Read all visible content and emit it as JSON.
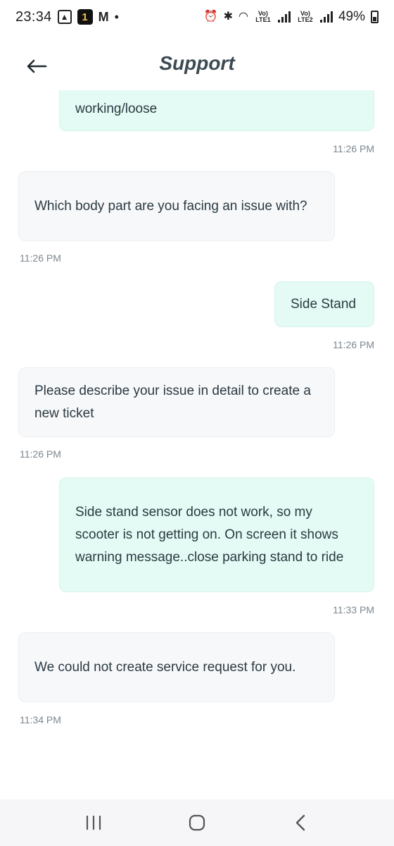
{
  "status_bar": {
    "time": "23:34",
    "badge": "1",
    "mail": "M",
    "dot": "•",
    "lte1": "Vo) LTE1",
    "lte2": "Vo) LTE2",
    "battery": "49%"
  },
  "header": {
    "title": "Support"
  },
  "messages": [
    {
      "sender": "user",
      "text": "working/loose",
      "time": "11:26 PM"
    },
    {
      "sender": "bot",
      "text": "Which body part are you facing an issue with?",
      "time": "11:26 PM"
    },
    {
      "sender": "user",
      "text": "Side Stand",
      "time": "11:26 PM"
    },
    {
      "sender": "bot",
      "text": "Please describe your issue in detail to create a new ticket",
      "time": "11:26 PM"
    },
    {
      "sender": "user",
      "text": "Side stand sensor does not work, so my scooter is not getting on. On screen it shows warning message..close parking stand to ride",
      "time": "11:33 PM"
    },
    {
      "sender": "bot",
      "text": "We could not create service request for you.",
      "time": "11:34 PM"
    }
  ],
  "colors": {
    "user_bubble": "#e3fbf4",
    "bot_bubble": "#f7f8fa",
    "title": "#3c4a52"
  },
  "icons": {
    "back": "back-arrow-icon",
    "recents": "recents-icon",
    "home": "home-icon",
    "nav_back": "nav-back-icon"
  }
}
